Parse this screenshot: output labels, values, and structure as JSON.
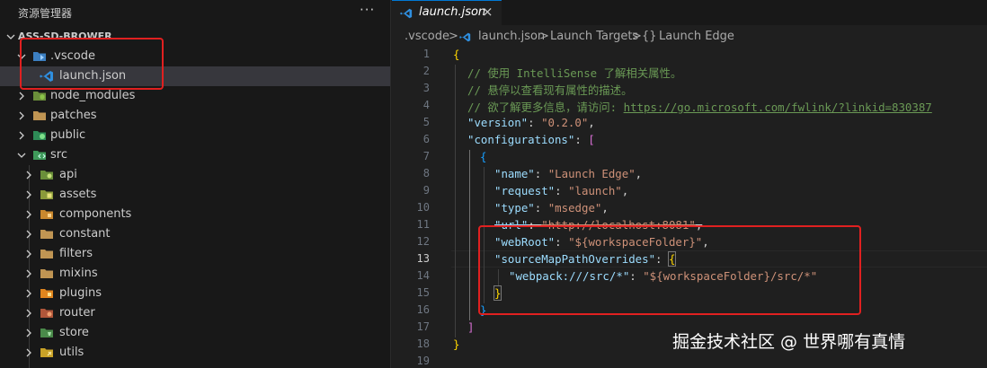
{
  "sidebar": {
    "title": "资源管理器",
    "more": "···",
    "project": "ASS-SD-BROWER",
    "items": [
      {
        "label": ".vscode",
        "icon": "vscode-folder-icon",
        "expanded": true
      },
      {
        "label": "launch.json",
        "icon": "vscode-file-icon",
        "selected": true
      },
      {
        "label": "node_modules",
        "icon": "node-folder-icon"
      },
      {
        "label": "patches",
        "icon": "folder-icon"
      },
      {
        "label": "public",
        "icon": "public-folder-icon"
      },
      {
        "label": "src",
        "icon": "src-folder-icon",
        "expanded": true
      },
      {
        "label": "api",
        "icon": "api-folder-icon"
      },
      {
        "label": "assets",
        "icon": "assets-folder-icon"
      },
      {
        "label": "components",
        "icon": "components-folder-icon"
      },
      {
        "label": "constant",
        "icon": "folder-icon"
      },
      {
        "label": "filters",
        "icon": "folder-icon"
      },
      {
        "label": "mixins",
        "icon": "folder-icon"
      },
      {
        "label": "plugins",
        "icon": "plugins-folder-icon"
      },
      {
        "label": "router",
        "icon": "router-folder-icon"
      },
      {
        "label": "store",
        "icon": "store-folder-icon"
      },
      {
        "label": "utils",
        "icon": "utils-folder-icon"
      }
    ]
  },
  "editor": {
    "tab": {
      "label": "launch.json",
      "close": "×"
    },
    "breadcrumb": {
      "folder": ".vscode",
      "sep": ">",
      "file": "launch.json",
      "section": "Launch Targets",
      "braces": "{}",
      "item": "Launch Edge"
    },
    "line_numbers": [
      "1",
      "2",
      "3",
      "4",
      "5",
      "6",
      "7",
      "8",
      "9",
      "10",
      "11",
      "12",
      "13",
      "14",
      "15",
      "16",
      "17",
      "18",
      "19"
    ],
    "current_line": "13",
    "code": {
      "l2": "// 使用 IntelliSense 了解相关属性。",
      "l3": "// 悬停以查看现有属性的描述。",
      "l4a": "// 欲了解更多信息，请访问: ",
      "l4b": "https://go.microsoft.com/fwlink/?linkid=830387",
      "k_version": "\"version\"",
      "v_version": "\"0.2.0\"",
      "k_configurations": "\"configurations\"",
      "k_name": "\"name\"",
      "v_name": "\"Launch Edge\"",
      "k_request": "\"request\"",
      "v_request": "\"launch\"",
      "k_type": "\"type\"",
      "v_type": "\"msedge\"",
      "k_url": "\"url\"",
      "v_url": "\"http://localhost:8081\"",
      "k_webroot": "\"webRoot\"",
      "v_webroot": "\"${workspaceFolder}\"",
      "k_smpo": "\"sourceMapPathOverrides\"",
      "k_webpack": "\"webpack:///src/*\"",
      "v_webpack": "\"${workspaceFolder}/src/*\"",
      "brace_open": "{",
      "brace_close": "}",
      "bracket_open": "[",
      "bracket_close": "]",
      "colon": ": ",
      "comma": ","
    }
  },
  "watermark": "掘金技术社区 @ 世界哪有真情",
  "colors": {
    "highlight_box": "#e02020",
    "comment": "#6a9955",
    "key": "#9cdcfe",
    "string": "#ce9178",
    "accent": "#0078d4"
  }
}
